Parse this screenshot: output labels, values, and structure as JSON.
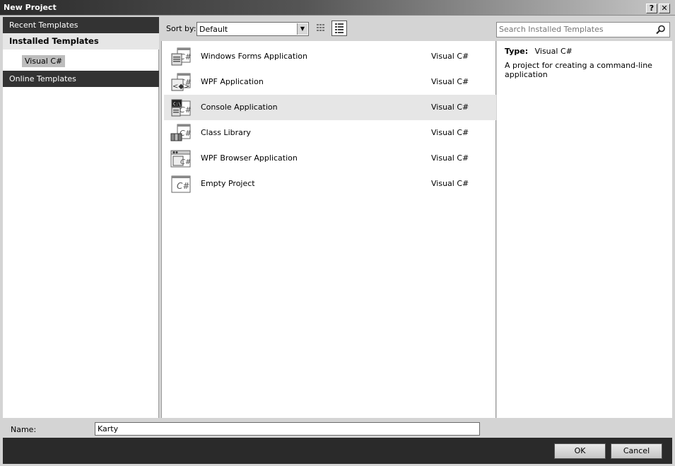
{
  "window": {
    "title": "New Project",
    "help_label": "?",
    "close_label": "✕"
  },
  "sidebar": {
    "recent": "Recent Templates",
    "installed": "Installed Templates",
    "installed_child": "Visual C#",
    "online": "Online Templates"
  },
  "toolbar": {
    "sort_label": "Sort by:",
    "sort_value": "Default",
    "view_small_icon": "small-icons-view-icon",
    "view_details_icon": "details-view-icon"
  },
  "search": {
    "placeholder": "Search Installed Templates",
    "icon": "search-icon"
  },
  "templates": [
    {
      "name": "Windows Forms Application",
      "lang": "Visual C#",
      "icon": "winforms-cs-icon",
      "selected": false
    },
    {
      "name": "WPF Application",
      "lang": "Visual C#",
      "icon": "wpf-cs-icon",
      "selected": false
    },
    {
      "name": "Console Application",
      "lang": "Visual C#",
      "icon": "console-cs-icon",
      "selected": true
    },
    {
      "name": "Class Library",
      "lang": "Visual C#",
      "icon": "class-library-cs-icon",
      "selected": false
    },
    {
      "name": "WPF Browser Application",
      "lang": "Visual C#",
      "icon": "wpf-browser-cs-icon",
      "selected": false
    },
    {
      "name": "Empty Project",
      "lang": "Visual C#",
      "icon": "empty-project-cs-icon",
      "selected": false
    }
  ],
  "details": {
    "type_label": "Type:",
    "type_value": "Visual C#",
    "description": "A project for creating a command-line application"
  },
  "name_field": {
    "label": "Name:",
    "value": "Karty"
  },
  "buttons": {
    "ok": "OK",
    "cancel": "Cancel"
  },
  "colors": {
    "title_bar_dark": "#2b2b2b",
    "sidebar_header": "#333333",
    "selection": "#e6e6e6",
    "footer": "#2a2a2a"
  }
}
